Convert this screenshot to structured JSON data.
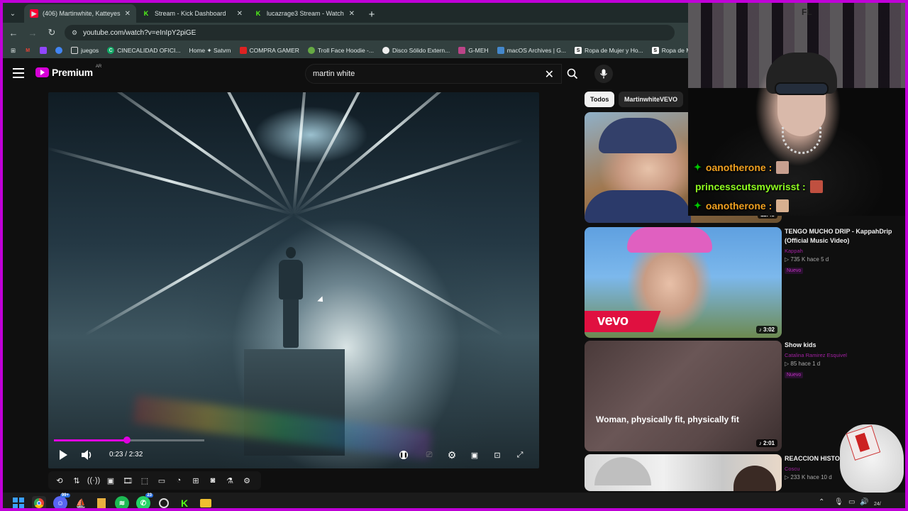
{
  "browser": {
    "tabs": [
      {
        "label": "(406) Martinwhite, Katteyes - P",
        "active": true,
        "icon_color": "#ff0033"
      },
      {
        "label": "Stream - Kick Dashboard",
        "active": false,
        "icon_color": "#53fc18"
      },
      {
        "label": "lucazrage3 Stream - Watch Live",
        "active": false,
        "icon_color": "#53fc18"
      }
    ],
    "url": "youtube.com/watch?v=eInIpY2piGE",
    "bookmarks": [
      "juegos",
      "CINECALIDAD OFICI...",
      "Home ✦ Satvrn",
      "COMPRA GAMER",
      "Troll Face Hoodie -...",
      "Disco Sólido Extern...",
      "G-MEH",
      "macOS Archives | G...",
      "Ropa de Mujer y Ho...",
      "Ropa de Mujer y H"
    ]
  },
  "youtube": {
    "logo_word": "Premium",
    "region": "AR",
    "search_value": "martin white",
    "accent": "#e000e0"
  },
  "player": {
    "time": "0:23 / 2:32",
    "progress_fraction": 0.15,
    "buffered_fraction": 0.31
  },
  "chips": {
    "all": "Todos",
    "channel": "MartinwhiteVEVO"
  },
  "related": [
    {
      "title": "",
      "channel": "",
      "stats": "",
      "badge": "",
      "duration": "11:48"
    },
    {
      "title": "TENGO MUCHO DRIP - KappahDrip (Official Music Video)",
      "channel": "Kappah",
      "stats": "▷ 735 K   hace 5 d",
      "badge": "Nuevo",
      "duration": "3:02",
      "thumb_text": "vevo"
    },
    {
      "title": "Show kids",
      "channel": "Catalina Ramirez Esquivel",
      "stats": "▷ 85   hace 1 d",
      "badge": "Nuevo",
      "duration": "2:01",
      "thumb_text": "Woman, physically fit, physically fit"
    },
    {
      "title": "REACCION HISTO... Querías A Mí -",
      "channel": "Coscu",
      "stats": "▷ 233 K   hace 10 d",
      "badge": "",
      "duration": ""
    }
  ],
  "overlay": {
    "cam_sign": "FL",
    "chat": [
      {
        "user": "oanotherone :",
        "color": "#f0a020",
        "star": true
      },
      {
        "user": "princesscutsmywrisst :",
        "color": "#90ff20",
        "star": false
      },
      {
        "user": "oanotherone :",
        "color": "#f0a020",
        "star": true
      }
    ]
  },
  "taskbar": {
    "discord_badge": "99+",
    "whatsapp_badge": "23",
    "clock": "24/"
  }
}
